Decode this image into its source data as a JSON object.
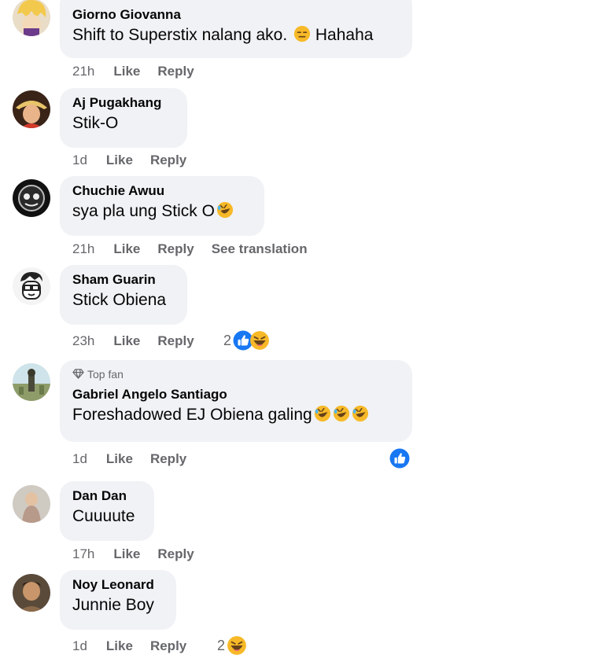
{
  "actions": {
    "like": "Like",
    "reply": "Reply",
    "see_translation": "See translation"
  },
  "comments": [
    {
      "author": "Giorno Giovanna",
      "text": "Shift to Superstix nalang ako.",
      "text_after": "Hahaha",
      "time": "21h"
    },
    {
      "author": "Aj Pugakhang",
      "text": "Stik-O",
      "time": "1d"
    },
    {
      "author": "Chuchie Awuu",
      "text": "sya pla ung Stick O",
      "time": "21h"
    },
    {
      "author": "Sham Guarin",
      "text": "Stick Obiena",
      "time": "23h",
      "reaction_count": "2"
    },
    {
      "badge": "Top fan",
      "author": "Gabriel Angelo Santiago",
      "text": "Foreshadowed EJ Obiena galing",
      "time": "1d"
    },
    {
      "author": "Dan Dan",
      "text": "Cuuuute",
      "time": "17h"
    },
    {
      "author": "Noy Leonard",
      "text": "Junnie Boy",
      "time": "1d",
      "reaction_count": "2"
    }
  ],
  "colors": {
    "like_blue": "#1877f2",
    "emoji_yellow": "#f7b928",
    "bubble": "#f0f2f5",
    "meta": "#65676b"
  }
}
